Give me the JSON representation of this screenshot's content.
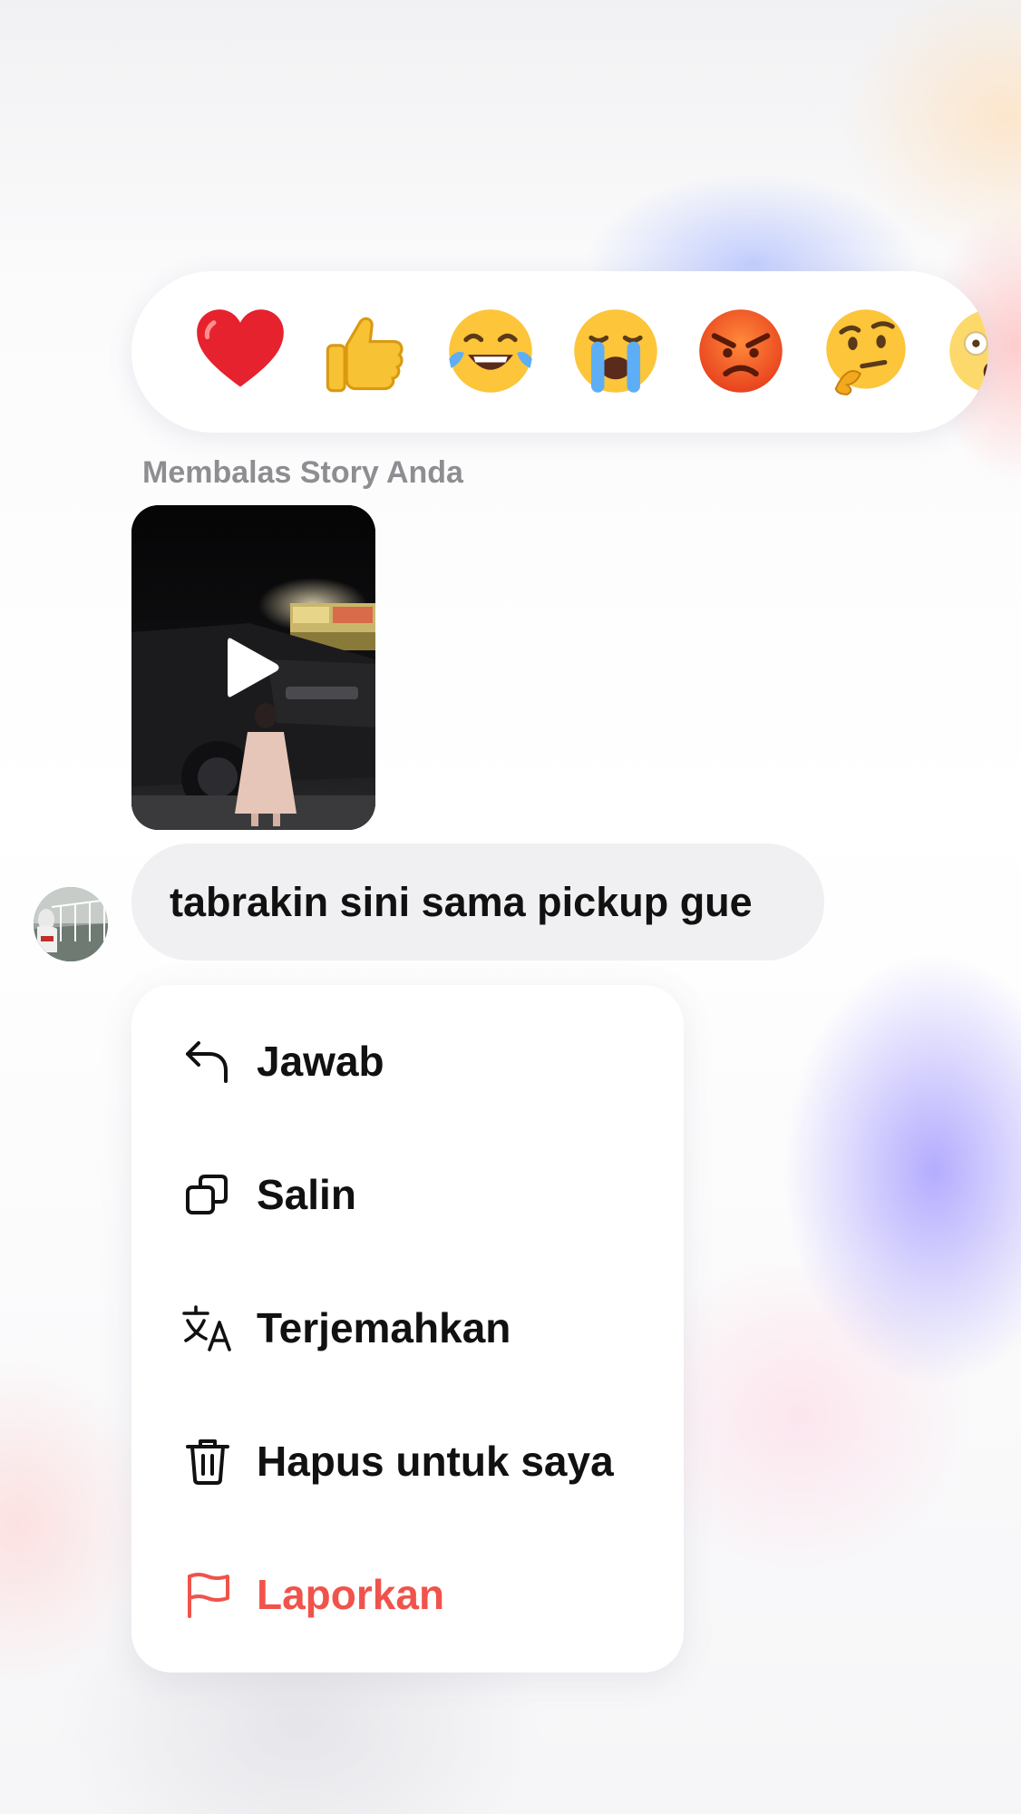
{
  "reactions": [
    {
      "icon": "heart-emoji"
    },
    {
      "icon": "thumbs-up-emoji"
    },
    {
      "icon": "tears-of-joy-emoji"
    },
    {
      "icon": "loudly-crying-emoji"
    },
    {
      "icon": "angry-face-emoji"
    },
    {
      "icon": "thinking-face-emoji"
    },
    {
      "icon": "astonished-face-emoji"
    }
  ],
  "message": {
    "reply_label": "Membalas Story Anda",
    "story_icon": "play-icon",
    "text": "tabrakin sini sama pickup gue"
  },
  "menu": {
    "items": [
      {
        "label": "Jawab",
        "icon": "reply-icon"
      },
      {
        "label": "Salin",
        "icon": "copy-icon"
      },
      {
        "label": "Terjemahkan",
        "icon": "translate-icon"
      },
      {
        "label": "Hapus untuk saya",
        "icon": "trash-icon"
      },
      {
        "label": "Laporkan",
        "icon": "flag-icon"
      }
    ]
  },
  "colors": {
    "danger": "#f0534b",
    "bubble": "#f0f0f2",
    "label_gray": "#8e8e92"
  }
}
